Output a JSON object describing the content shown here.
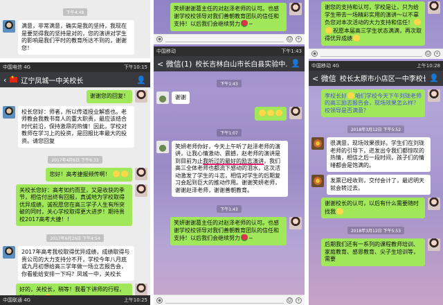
{
  "panel1_top": {
    "time": "下午4:48",
    "msg": "满意，非常满意，确实是我的坚持，我现在是要觉得我的坚持是对的，您的演讲对学生的影响是我们平时的教育所达不到的，谢谢您！"
  },
  "panel1_bottom": {
    "status": {
      "left": "中国电信 4G",
      "right": "下午10:15"
    },
    "title": "辽宁凤城一中关校长",
    "msg1": "谢谢您的回复！",
    "msg2": "校长您好：师者，所以传道授业解惑也。老师教会我教书育人的重大职责，最应该结合时代前沿，保持激昂的热情！因此，学校对教师在学习上的投资，是回报比率最大的投资。请您回复",
    "time1": "2017年4月6日 下午6:33",
    "msg3": "您好！高考捷报频传啊！",
    "msg4": "关校长您好：高考如约而至，又是收获的季节，相信付出终有回报，真诚地为学校取得优异成绩，诚祝愿您在高三学子人生有所突破的同时，关心学校取得更大进步！期待贵校2017高考大捷！！",
    "time2": "2017年6月26日 下午4:54",
    "msg5": "2017年高考我校取得优异成绩，成绩取得与贵公司的大力支持分不开，学校今年八月底或九月初想给高三学年做一场立志报告会，你看能给安排一下吗？凤城一中，关校长",
    "msg6": "好的，关校长，稍等！我看下讲师的行程，稍等会。",
    "status2": {
      "left": "中国联通 4G",
      "right": "上午10:25"
    }
  },
  "panel2": {
    "status": {
      "left": "中国移动",
      "right": "下午1:43"
    },
    "back_label": "< 微信(1)",
    "title": "校长吉林白山市长白县实验中...",
    "top_msg": "笑妍谢谢葛主任的对赵泽老师的认可。也感谢学校校领导对我们善朝教育团队的信任和支持！以后我们会继续努力",
    "time1": "下午1:43",
    "msg1": "谢谢",
    "time2": "下午1:07",
    "msg2_before": "笑妍老师你好，今天上午听了赵泽老师的演讲，让我心情激动、震撼，赵老师的演讲是到目前为止",
    "msg2_underline": "我听过的最好的励志演讲",
    "msg2_after": "，我们高三全体老师也都流下感动的泪水，这次活动激发了学生的斗志，相信对学生的后期复习会起到巨大的推动作用。谢谢笑妍老师，谢谢赵泽老师，谢谢善朝教育。",
    "time3": "下午1:43",
    "msg3": "笑妍谢谢葛主任的对赵泽老师的认可。也感谢学校校领导对我们善朝教育团队的信任和支持！以后我们会继续努力"
  },
  "panel3": {
    "status": {
      "left": "中国移动 4G",
      "right": "上午10:28"
    },
    "back_label": "< 微信",
    "title": "校长太原市小店区一中李校长",
    "top_msg": "谢您的支持和认可，学校是让，只为给学生带去一场精彩实用的演讲～以不辜负您对本次活动的大力支持和信任！",
    "top_msg2": "祝愿本届高三学生状态满满，再次取得优异成绩",
    "msg1": "李校长好",
    "msg1_b": "咱们学校今天下午刘珑老师的高三励志报告会，现场效果怎么样？校领导是否满意？",
    "time1": "2018年3月12日 下午5:52",
    "msg2": "很满意，现场效果很好。学生们在刘珑老师的引导下，迸发出令我们都惊叹的热情，相信之后一段时间，孩子们的情绪都会是饱满的。",
    "msg3": "发票已经收到，交付会计了，最迟明天就会转过去。",
    "msg4": "谢谢校长的认可，以后有什么需要随时找我",
    "time2": "2018年3月12日 下午5:53",
    "msg5": "后期我们还有一系列的课程教师培训、家庭教育、感恩教育、尖子生培训等，需要"
  }
}
